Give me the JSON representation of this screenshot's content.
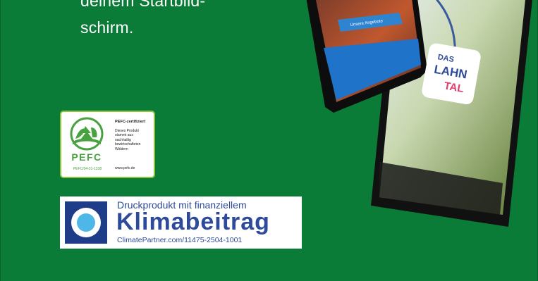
{
  "headline": {
    "line1": "deinem Startbild-",
    "line2": "schirm."
  },
  "app_screen": {
    "button_label": "Unsere Angebote"
  },
  "app_icon": {
    "word1": "DAS",
    "word2": "LAHN",
    "word3": "TAL"
  },
  "pefc": {
    "title": "PEFC-zertifiziert",
    "body": "Dieses Produkt stammt aus nachhaltig bewirtschafteten Wäldern",
    "url": "www.pefc.de",
    "logo_word": "PEFC",
    "code": "PEFC/04-31-1338"
  },
  "climate": {
    "line1": "Druckprodukt mit finanziellem",
    "line2": "Klimabeitrag",
    "line3": "ClimatePartner.com/11475-2504-1001"
  },
  "colors": {
    "background": "#0a7c38",
    "pefc_green": "#48a23f",
    "climate_blue": "#2e4a9a"
  }
}
